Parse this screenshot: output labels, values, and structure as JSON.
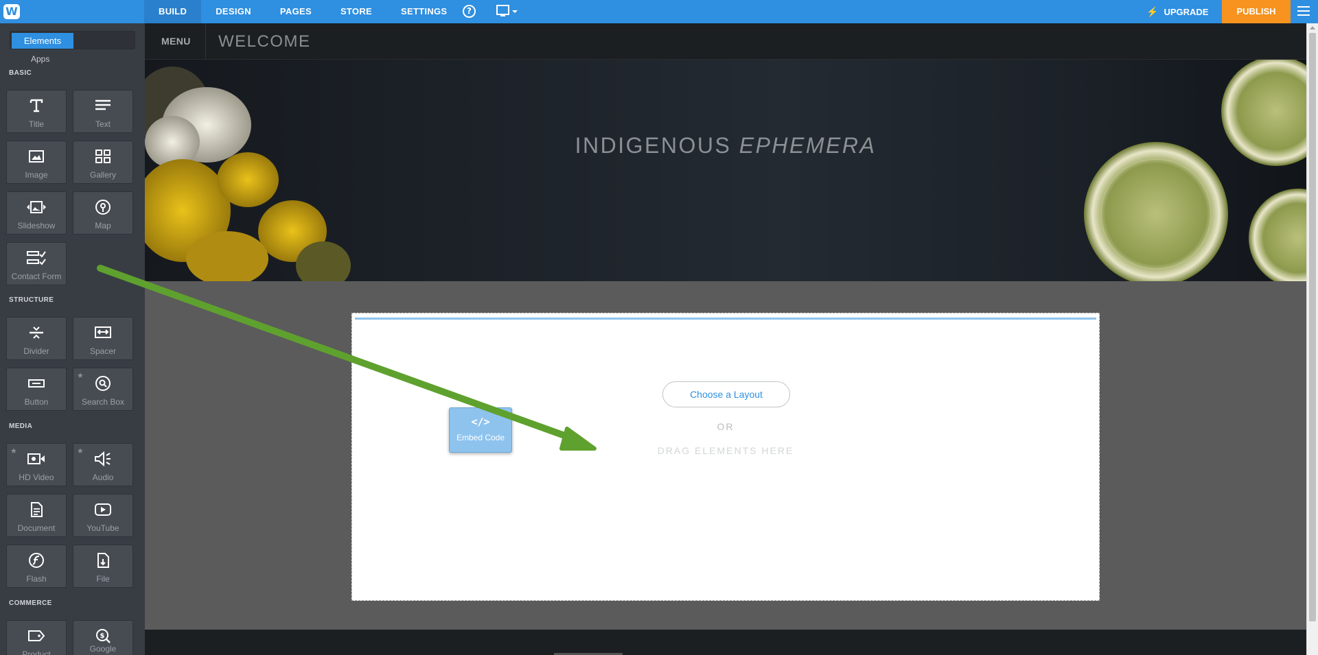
{
  "topbar": {
    "nav": [
      "BUILD",
      "DESIGN",
      "PAGES",
      "STORE",
      "SETTINGS"
    ],
    "help": "?",
    "upgrade": "UPGRADE",
    "publish": "PUBLISH"
  },
  "sidebar": {
    "toggle": {
      "elements": "Elements",
      "apps": "Apps"
    },
    "sections": {
      "basic": "BASIC",
      "structure": "STRUCTURE",
      "media": "MEDIA",
      "commerce": "COMMERCE"
    },
    "basic": [
      "Title",
      "Text",
      "Image",
      "Gallery",
      "Slideshow",
      "Map",
      "Contact Form"
    ],
    "structure": [
      "Divider",
      "Spacer",
      "Button",
      "Search Box"
    ],
    "media": [
      "HD Video",
      "Audio",
      "Document",
      "YouTube",
      "Flash",
      "File"
    ],
    "commerce": [
      "Product",
      "Google"
    ]
  },
  "site": {
    "menu": "MENU",
    "title": "WELCOME",
    "hero_title_main": "INDIGENOUS ",
    "hero_title_italic": "EPHEMERA"
  },
  "dropzone": {
    "choose_layout": "Choose a Layout",
    "or": "OR",
    "drag_here": "DRAG ELEMENTS HERE"
  },
  "drag_element": {
    "icon": "</>",
    "label": "Embed Code"
  },
  "colors": {
    "accent": "#2f8fe0",
    "publish": "#f7931e",
    "arrow": "#5fa12e",
    "sidebar": "#383d44"
  },
  "icons": {
    "title": "title-icon",
    "text": "text-icon",
    "image": "image-icon",
    "gallery": "gallery-icon",
    "slideshow": "slideshow-icon",
    "map": "map-pin-icon",
    "contact_form": "contact-form-icon",
    "divider": "divider-icon",
    "spacer": "spacer-icon",
    "button": "button-icon",
    "search_box": "search-icon",
    "hd_video": "video-icon",
    "audio": "audio-icon",
    "document": "document-icon",
    "youtube": "youtube-icon",
    "flash": "flash-icon",
    "file": "file-icon",
    "product": "tag-icon",
    "google": "google-icon"
  }
}
